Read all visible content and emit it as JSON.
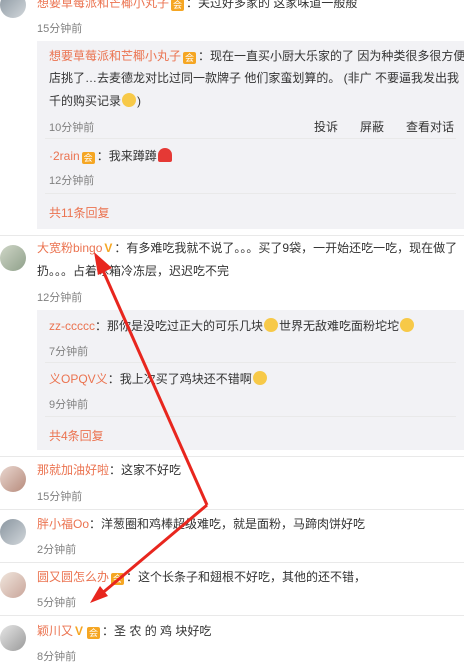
{
  "c0": {
    "name": "想要草莓派和芒椰小丸子",
    "text": "：关过好多家的 这家味道一般般",
    "time": "15分钟前"
  },
  "r1": {
    "name": "想要草莓派和芒椰小丸子",
    "line1": "：现在一直买小厨大乐家的了 因为种类很多很方便",
    "line2": "店挑了…去麦德龙对比过同一款牌子 他们家蛮划算的。 (非广 不要逼我发出我",
    "line3": "千的购买记录",
    "time": "10分钟前",
    "actions": {
      "report": "投诉",
      "block": "屏蔽",
      "view": "查看对话"
    }
  },
  "r2": {
    "name": "·2rain",
    "text": "：我来蹲蹲",
    "time": "12分钟前"
  },
  "more1": "共11条回复",
  "c1": {
    "name": "大宽粉bingo",
    "line1": "：有多难吃我就不说了。。。买了9袋，一开始还吃一吃，现在做了",
    "line2": "扔。。。占着冰箱冷冻层，迟迟吃不完",
    "time": "12分钟前"
  },
  "r3": {
    "name": "zz-ccccc",
    "text": "：那你是没吃过正大的可乐几块",
    "text2": "世界无敌难吃面粉坨坨",
    "time": "7分钟前"
  },
  "r4": {
    "name": "义OPQV义",
    "text": "：我上次买了鸡块还不错啊",
    "time": "9分钟前"
  },
  "more2": "共4条回复",
  "c2": {
    "name": "那就加油好啦",
    "text": "：这家不好吃",
    "time": "15分钟前"
  },
  "c3": {
    "name": "胖小福Oo",
    "text": "：洋葱圈和鸡棒超级难吃，就是面粉，马蹄肉饼好吃",
    "time": "2分钟前"
  },
  "c4": {
    "name": "圆又圆怎么办",
    "text": "：这个长条子和翅根不好吃，其他的还不错，",
    "time": "5分钟前"
  },
  "c5": {
    "name": "颖川又",
    "text": "：圣 农 的 鸡 块好吃",
    "time": "8分钟前"
  },
  "colors": {
    "accent": "#eb7350",
    "arrow": "#e8261e"
  }
}
